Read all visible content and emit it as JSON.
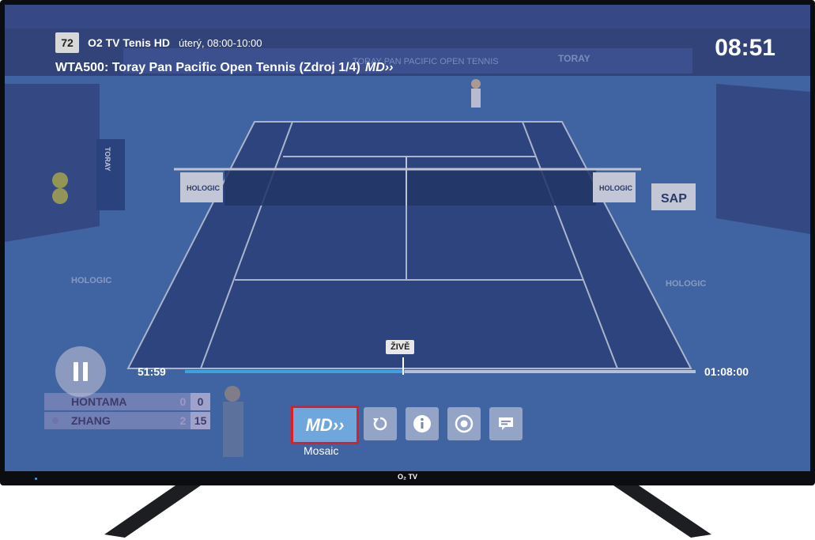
{
  "header": {
    "channel_number": "72",
    "channel_name": "O2 TV Tenis HD",
    "schedule": "úterý, 08:00-10:00",
    "program_title": "WTA500: Toray Pan Pacific Open Tennis (Zdroj 1/4)",
    "program_badge": "MD››",
    "clock": "08:51"
  },
  "playback": {
    "state_icon": "pause-icon",
    "time_start": "51:59",
    "time_end": "01:08:00",
    "live_label": "ŽIVĚ",
    "progress_fraction": 0.43
  },
  "scoreboard": {
    "players": [
      {
        "name": "HONTAMA",
        "games": "0",
        "points": "0"
      },
      {
        "name": "ZHANG",
        "games": "2",
        "points": "15"
      }
    ]
  },
  "court_ads": {
    "left_banner": "HOLOGIC",
    "right_banner": "HOLOGIC",
    "court_left": "HOLOGIC",
    "court_right": "HOLOGIC",
    "sponsor": "SAP",
    "umpire_chair": "TORAY",
    "back_wall_1": "TORAY PAN PACIFIC OPEN TENNIS",
    "back_wall_2": "TORAY"
  },
  "controls": {
    "focused": "mosaic",
    "buttons": [
      {
        "id": "mosaic",
        "icon": "mosaic-icon",
        "label": "Mosaic",
        "badge": "MD››"
      },
      {
        "id": "restart",
        "icon": "restart-icon"
      },
      {
        "id": "info",
        "icon": "info-icon"
      },
      {
        "id": "record",
        "icon": "record-icon"
      },
      {
        "id": "subtitles",
        "icon": "subtitles-icon"
      }
    ]
  },
  "tv": {
    "brand": "O₂ TV"
  },
  "colors": {
    "court_outer": "#4670b0",
    "court_inner": "#2f4a86",
    "progress_fill": "#3aa3e0",
    "focus_border": "#e01d22",
    "mosaic_button_bg": "#6fa6dc"
  }
}
